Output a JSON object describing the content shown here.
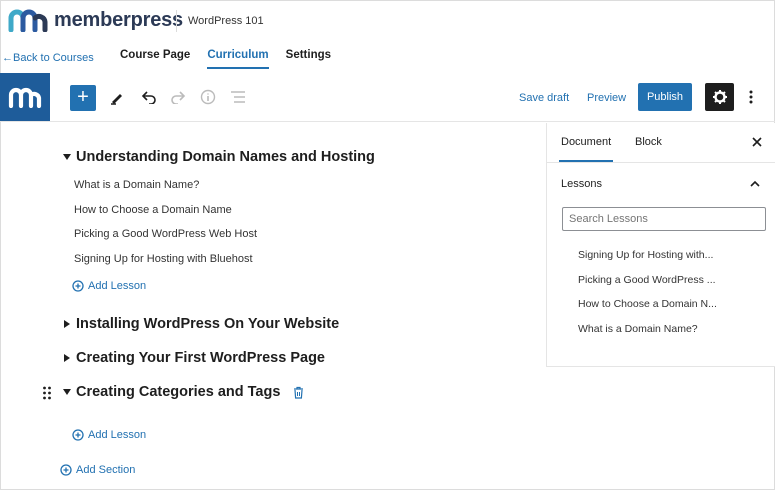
{
  "header": {
    "brand_name": "memberpress",
    "course_title": "WordPress 101"
  },
  "nav": {
    "back_link": "←Back to Courses",
    "tabs": [
      {
        "label": "Course Page",
        "active": false
      },
      {
        "label": "Curriculum",
        "active": true
      },
      {
        "label": "Settings",
        "active": false
      }
    ]
  },
  "toolbar": {
    "add_label": "+",
    "save_draft": "Save draft",
    "preview": "Preview",
    "publish": "Publish",
    "icons": [
      "memberpress-logo-icon",
      "add-block-icon",
      "pen-icon",
      "undo-icon",
      "redo-icon",
      "info-icon",
      "list-view-icon",
      "gear-icon",
      "more-vertical-icon"
    ]
  },
  "curriculum": {
    "sections": [
      {
        "title": "Understanding Domain Names and Hosting",
        "expanded": true,
        "lessons": [
          "What is a Domain Name?",
          "How to Choose a Domain Name",
          "Picking a Good WordPress Web Host",
          "Signing Up for Hosting with Bluehost"
        ]
      },
      {
        "title": "Installing WordPress On Your Website",
        "expanded": false,
        "lessons": []
      },
      {
        "title": "Creating Your First WordPress Page",
        "expanded": false,
        "lessons": []
      },
      {
        "title": "Creating Categories and Tags",
        "expanded": true,
        "lessons": []
      }
    ],
    "add_lesson_label": "Add Lesson",
    "add_section_label": "Add Section"
  },
  "sidebar": {
    "tabs": [
      {
        "label": "Document",
        "active": true
      },
      {
        "label": "Block",
        "active": false
      }
    ],
    "close_icon": "×",
    "lessons_heading": "Lessons",
    "search_placeholder": "Search Lessons",
    "lessons": [
      "Signing Up for Hosting with...",
      "Picking a Good WordPress ...",
      "How to Choose a Domain N...",
      "What is a Domain Name?"
    ]
  },
  "colors": {
    "accent": "#2271b1",
    "logo_bg": "#1e5c9a",
    "brand_teal": "#3fa9c8",
    "dark": "#1e1e1e"
  }
}
